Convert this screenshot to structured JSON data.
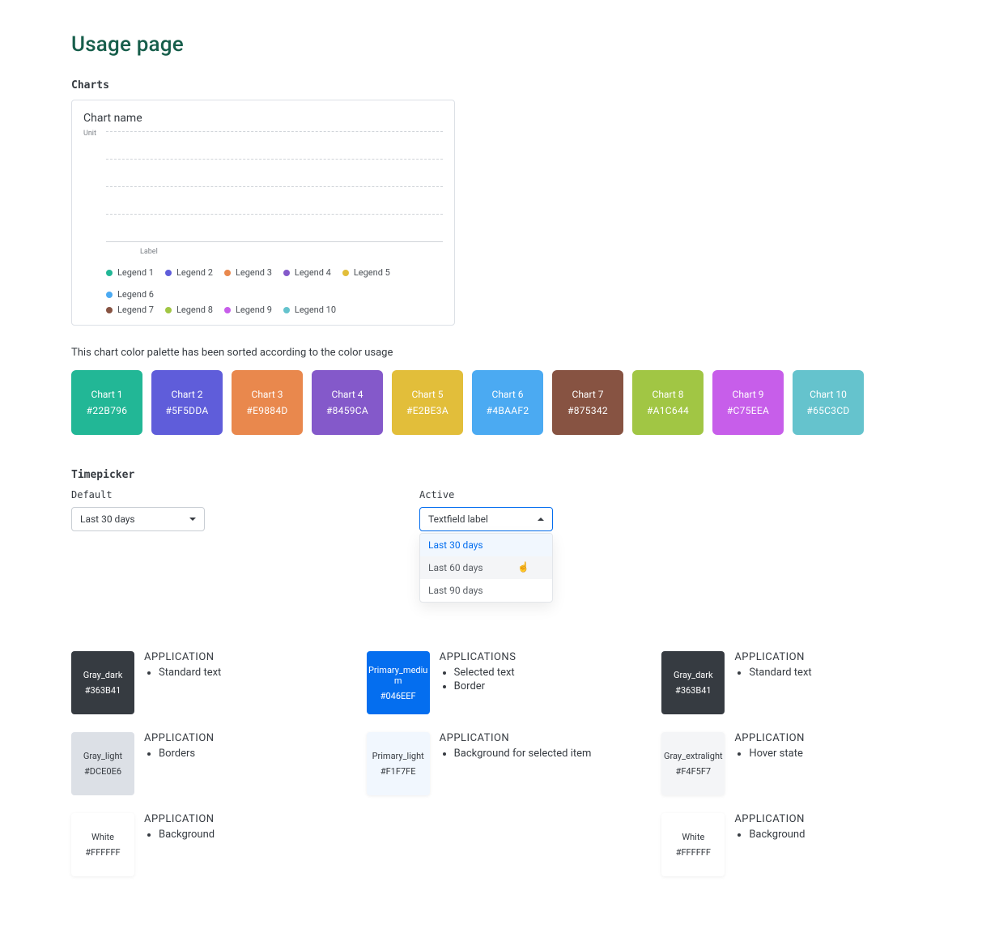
{
  "page": {
    "title": "Usage page"
  },
  "sections": {
    "charts": "Charts",
    "timepicker": "Timepicker"
  },
  "chart_card": {
    "title": "Chart name",
    "y_unit": "Unit",
    "x_label": "Label",
    "legends": [
      {
        "label": "Legend 1",
        "color": "#22B796"
      },
      {
        "label": "Legend 2",
        "color": "#5F5DDA"
      },
      {
        "label": "Legend 3",
        "color": "#E9884D"
      },
      {
        "label": "Legend 4",
        "color": "#8459CA"
      },
      {
        "label": "Legend 5",
        "color": "#E2BE3A"
      },
      {
        "label": "Legend 6",
        "color": "#4BAAF2"
      },
      {
        "label": "Legend 7",
        "color": "#875342"
      },
      {
        "label": "Legend 8",
        "color": "#A1C644"
      },
      {
        "label": "Legend 9",
        "color": "#C75EEA"
      },
      {
        "label": "Legend 10",
        "color": "#65C3CD"
      }
    ]
  },
  "palette_note": "This chart color palette has been sorted according to the color usage",
  "palette": [
    {
      "name": "Chart 1",
      "hex": "#22B796"
    },
    {
      "name": "Chart 2",
      "hex": "#5F5DDA"
    },
    {
      "name": "Chart 3",
      "hex": "#E9884D"
    },
    {
      "name": "Chart 4",
      "hex": "#8459CA"
    },
    {
      "name": "Chart 5",
      "hex": "#E2BE3A"
    },
    {
      "name": "Chart 6",
      "hex": "#4BAAF2"
    },
    {
      "name": "Chart 7",
      "hex": "#875342"
    },
    {
      "name": "Chart 8",
      "hex": "#A1C644"
    },
    {
      "name": "Chart 9",
      "hex": "#C75EEA"
    },
    {
      "name": "Chart 10",
      "hex": "#65C3CD"
    }
  ],
  "timepicker": {
    "default": {
      "label": "Default",
      "value": "Last 30 days"
    },
    "active": {
      "label": "Active",
      "value": "Textfield label",
      "options": [
        "Last 30 days",
        "Last 60 days",
        "Last 90 days"
      ]
    }
  },
  "specs": [
    {
      "name": "Gray_dark",
      "hex": "#363B41",
      "bg": "#363B41",
      "text": "dark",
      "head": "APPLICATION",
      "uses": [
        "Standard text"
      ],
      "shadow": false
    },
    {
      "name": "Primary_medium",
      "hex": "#046EEF",
      "bg": "#046EEF",
      "text": "dark",
      "head": "APPLICATIONS",
      "uses": [
        "Selected text",
        "Border"
      ],
      "shadow": false
    },
    {
      "name": "Gray_dark",
      "hex": "#363B41",
      "bg": "#363B41",
      "text": "dark",
      "head": "APPLICATION",
      "uses": [
        "Standard text"
      ],
      "shadow": false
    },
    {
      "name": "Gray_light",
      "hex": "#DCE0E6",
      "bg": "#DCE0E6",
      "text": "light",
      "head": "APPLICATION",
      "uses": [
        "Borders"
      ],
      "shadow": false
    },
    {
      "name": "Primary_light",
      "hex": "#F1F7FE",
      "bg": "#F1F7FE",
      "text": "light",
      "head": "APPLICATION",
      "uses": [
        "Background for selected item"
      ],
      "shadow": true
    },
    {
      "name": "Gray_extralight",
      "hex": "#F4F5F7",
      "bg": "#F4F5F7",
      "text": "light",
      "head": "APPLICATION",
      "uses": [
        "Hover state"
      ],
      "shadow": true
    },
    {
      "name": "White",
      "hex": "#FFFFFF",
      "bg": "#FFFFFF",
      "text": "light",
      "head": "APPLICATION",
      "uses": [
        "Background"
      ],
      "shadow": true
    },
    null,
    {
      "name": "White",
      "hex": "#FFFFFF",
      "bg": "#FFFFFF",
      "text": "light",
      "head": "APPLICATION",
      "uses": [
        "Background"
      ],
      "shadow": true
    }
  ]
}
